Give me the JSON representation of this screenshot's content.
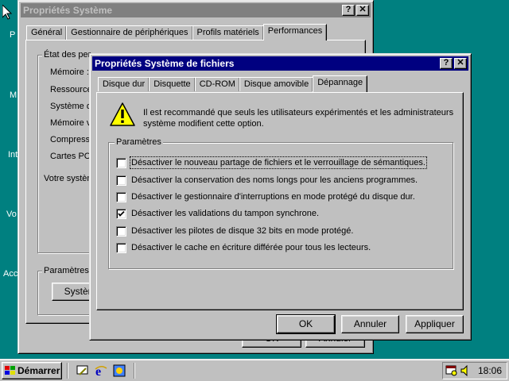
{
  "desktop": {
    "icon_labels": [
      "P",
      "M",
      "Int",
      "Vo",
      "Acc"
    ]
  },
  "bg_window": {
    "title": "Propriétés Système",
    "help_label": "?",
    "close_label": "✕",
    "tabs": [
      "Général",
      "Gestionnaire de périphériques",
      "Profils matériels",
      "Performances"
    ],
    "selected_tab": "Performances",
    "group_title": "État des per",
    "rows": [
      "Mémoire :",
      "Ressource",
      "Système d",
      "Mémoire v",
      "Compressi",
      "Cartes PC",
      "Votre systèn"
    ],
    "params_title": "Paramètres",
    "system_button": "Système",
    "ok_label": "OK",
    "cancel_label": "Annuler"
  },
  "dialog": {
    "title": "Propriétés Système de fichiers",
    "help_label": "?",
    "close_label": "✕",
    "tabs": [
      "Disque dur",
      "Disquette",
      "CD-ROM",
      "Disque amovible",
      "Dépannage"
    ],
    "selected_tab": "Dépannage",
    "warning_text": "Il est recommandé que seuls les utilisateurs expérimentés et les administrateurs système modifient cette option.",
    "params_title": "Paramètres",
    "options": [
      {
        "label": "Désactiver le nouveau partage de fichiers et le verrouillage de sémantiques.",
        "checked": false
      },
      {
        "label": "Désactiver la conservation des noms longs pour les anciens programmes.",
        "checked": false
      },
      {
        "label": "Désactiver le gestionnaire d'interruptions en mode protégé du disque dur.",
        "checked": false
      },
      {
        "label": "Désactiver les validations du tampon synchrone.",
        "checked": true
      },
      {
        "label": "Désactiver les pilotes de disque 32 bits en mode protégé.",
        "checked": false
      },
      {
        "label": "Désactiver le cache en écriture différée pour tous les lecteurs.",
        "checked": false
      }
    ],
    "ok_label": "OK",
    "cancel_label": "Annuler",
    "apply_label": "Appliquer"
  },
  "taskbar": {
    "start_label": "Démarrer",
    "quick_launch": [
      "show-desktop-icon",
      "internet-explorer-icon",
      "channels-icon"
    ],
    "clock": "18:06"
  }
}
